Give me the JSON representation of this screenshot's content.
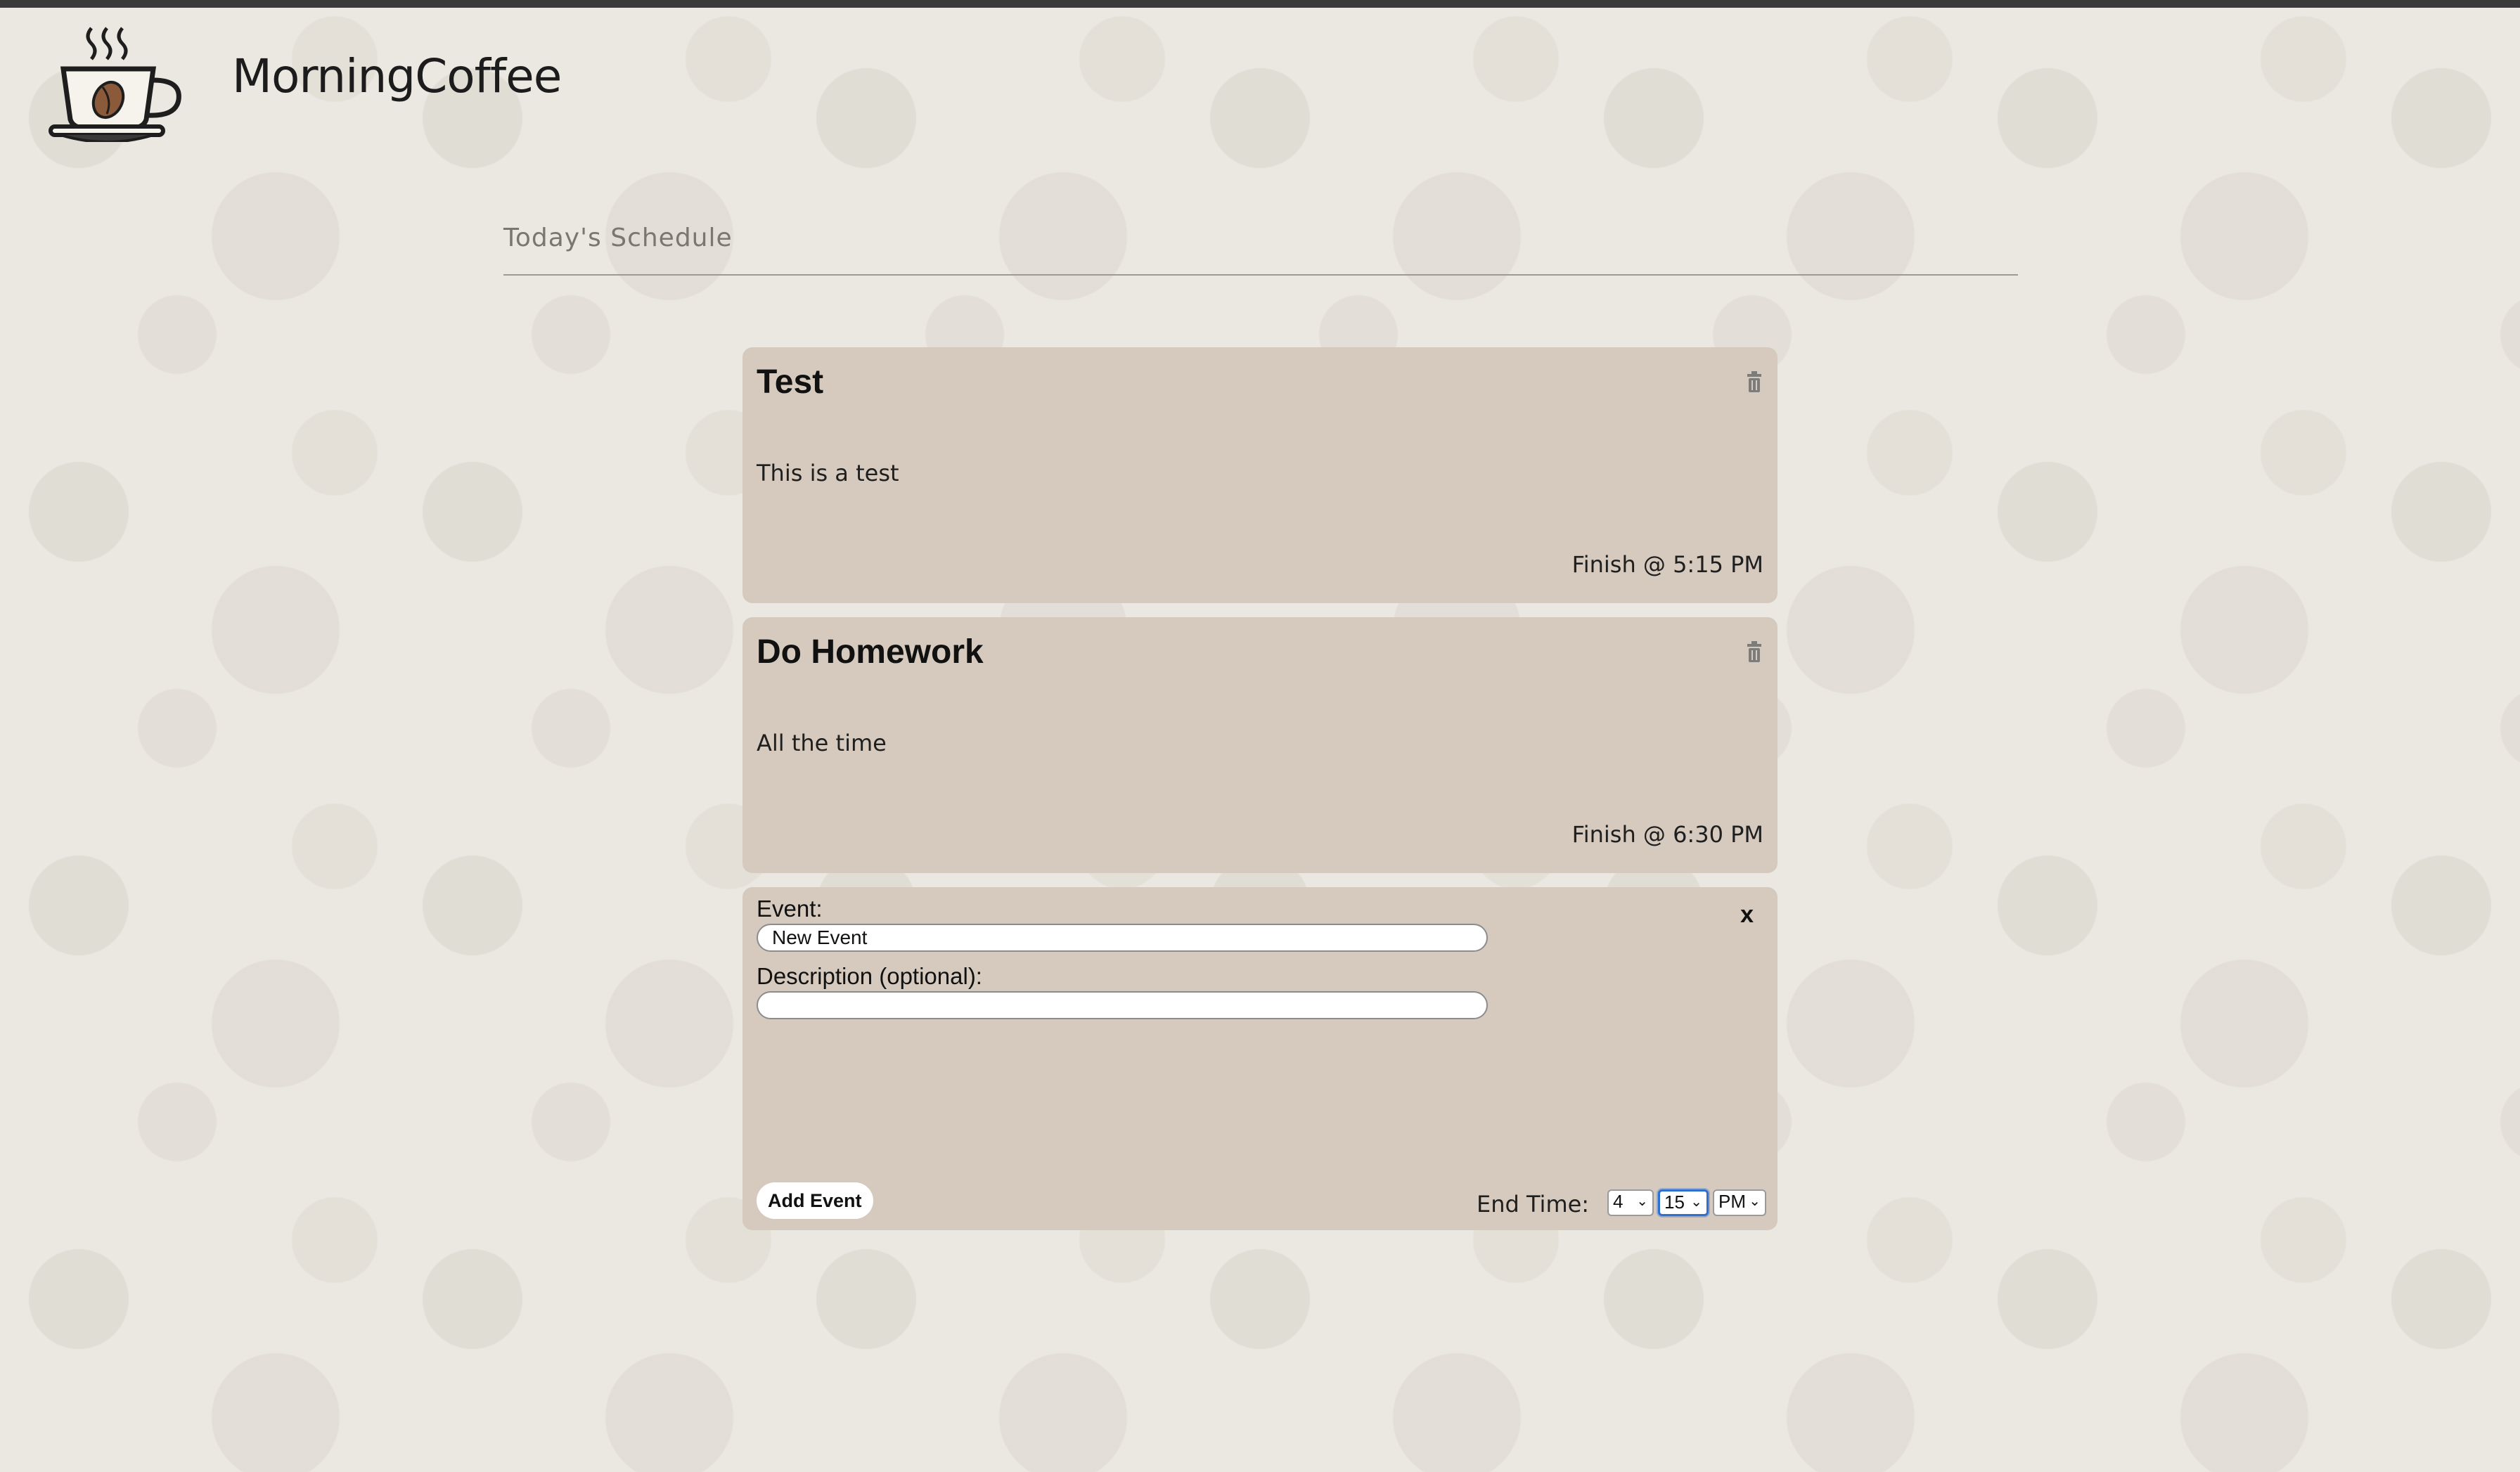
{
  "app": {
    "brand": "MorningCoffee",
    "logo_icon": "coffee-cup-icon"
  },
  "schedule": {
    "title": "Today's Schedule",
    "events": [
      {
        "title": "Test",
        "description": "This is a test",
        "finish": "Finish @ 5:15 PM",
        "delete_icon": "trash-icon"
      },
      {
        "title": "Do Homework",
        "description": "All the time",
        "finish": "Finish @ 6:30 PM",
        "delete_icon": "trash-icon"
      }
    ]
  },
  "new_event_form": {
    "event_label": "Event:",
    "event_value": "New Event",
    "description_label": "Description (optional):",
    "description_value": "",
    "close_label": "x",
    "add_button_label": "Add Event",
    "end_time_label": "End Time:",
    "hour": "4",
    "minute": "15",
    "period": "PM"
  },
  "colors": {
    "card_background": "#d5cabd",
    "page_background": "#ebe8e2",
    "focus_ring": "#2f6fd0"
  }
}
